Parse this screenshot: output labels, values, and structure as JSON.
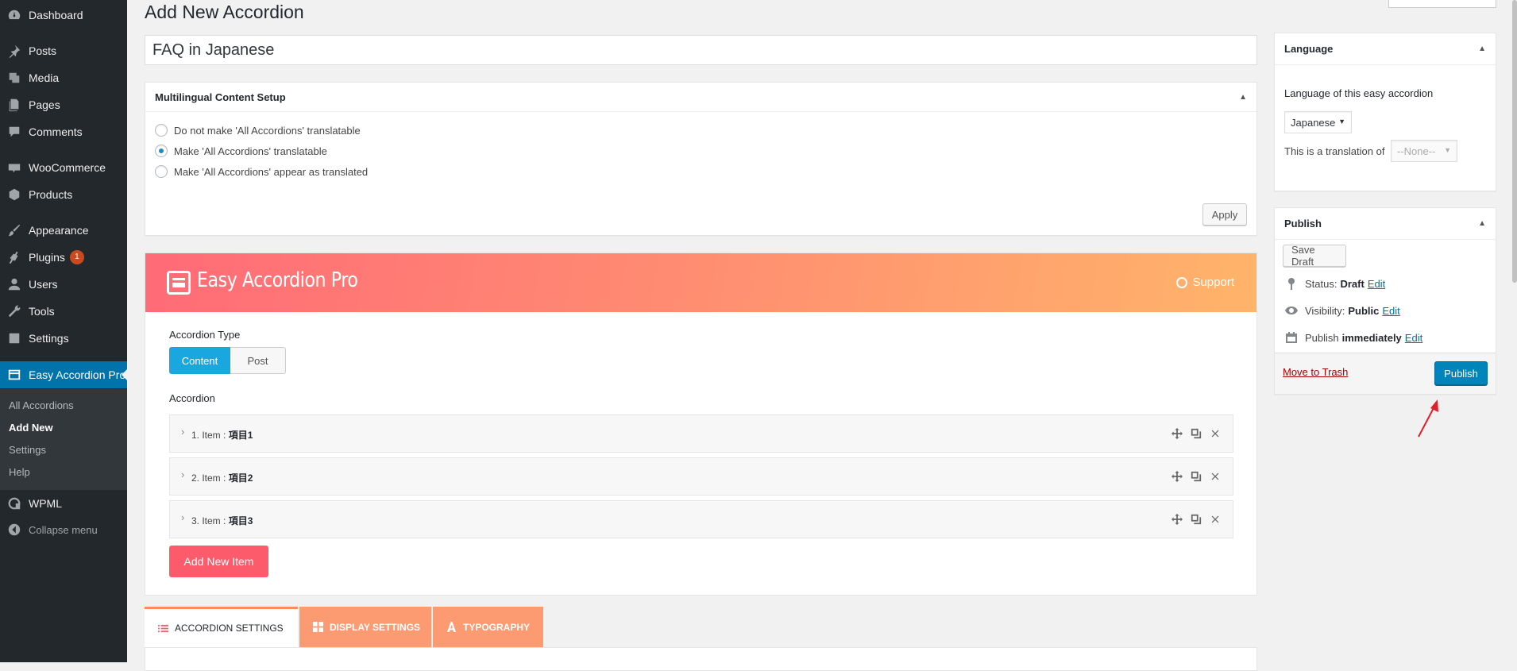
{
  "sidebar": {
    "items": [
      {
        "label": "Dashboard",
        "icon": "dashboard-icon"
      },
      {
        "label": "Posts",
        "icon": "pin-icon"
      },
      {
        "label": "Media",
        "icon": "media-icon"
      },
      {
        "label": "Pages",
        "icon": "pages-icon"
      },
      {
        "label": "Comments",
        "icon": "comment-icon"
      },
      {
        "label": "WooCommerce",
        "icon": "woocommerce-icon"
      },
      {
        "label": "Products",
        "icon": "box-icon"
      },
      {
        "label": "Appearance",
        "icon": "brush-icon"
      },
      {
        "label": "Plugins",
        "icon": "plugin-icon",
        "badge": "1"
      },
      {
        "label": "Users",
        "icon": "user-icon"
      },
      {
        "label": "Tools",
        "icon": "wrench-icon"
      },
      {
        "label": "Settings",
        "icon": "settings-icon"
      },
      {
        "label": "Easy Accordion Pro",
        "icon": "accordion-icon"
      },
      {
        "label": "WPML",
        "icon": "wpml-icon"
      },
      {
        "label": "Collapse menu",
        "icon": "collapse-icon"
      }
    ],
    "submenu": [
      "All Accordions",
      "Add New",
      "Settings",
      "Help"
    ]
  },
  "page": {
    "title": "Add New Accordion",
    "post_title": "FAQ in Japanese"
  },
  "multilingual": {
    "heading": "Multilingual Content Setup",
    "options": [
      "Do not make 'All Accordions' translatable",
      "Make 'All Accordions' translatable",
      "Make 'All Accordions' appear as translated"
    ],
    "selected_index": 1,
    "apply_label": "Apply"
  },
  "eap": {
    "brand": "Easy Accordion Pro",
    "support": "Support",
    "type_label": "Accordion Type",
    "type_options": [
      "Content",
      "Post"
    ],
    "accordion_label": "Accordion",
    "items": [
      {
        "prefix": "1. Item : ",
        "name": "項目1"
      },
      {
        "prefix": "2. Item : ",
        "name": "項目2"
      },
      {
        "prefix": "3. Item : ",
        "name": "項目3"
      }
    ],
    "add_item": "Add New Item",
    "tabs": [
      "ACCORDION SETTINGS",
      "DISPLAY SETTINGS",
      "TYPOGRAPHY"
    ]
  },
  "language_box": {
    "heading": "Language",
    "label": "Language of this easy accordion",
    "selected_language": "Japanese",
    "translation_label": "This is a translation of",
    "translation_value": "--None--"
  },
  "publish_box": {
    "heading": "Publish",
    "save_draft": "Save Draft",
    "status_label": "Status:",
    "status_value": "Draft",
    "visibility_label": "Visibility:",
    "visibility_value": "Public",
    "schedule_label": "Publish",
    "schedule_value": "immediately",
    "edit": "Edit",
    "trash": "Move to Trash",
    "publish": "Publish"
  },
  "colors": {
    "sidebar_bg": "#23282d",
    "submenu_bg": "#32373c",
    "wp_blue": "#0073aa",
    "accent_cyan": "#1aa6df",
    "add_button": "#fc5b6c",
    "tab_orange": "#fc9a71",
    "annotation_arrow": "#e0202a"
  }
}
